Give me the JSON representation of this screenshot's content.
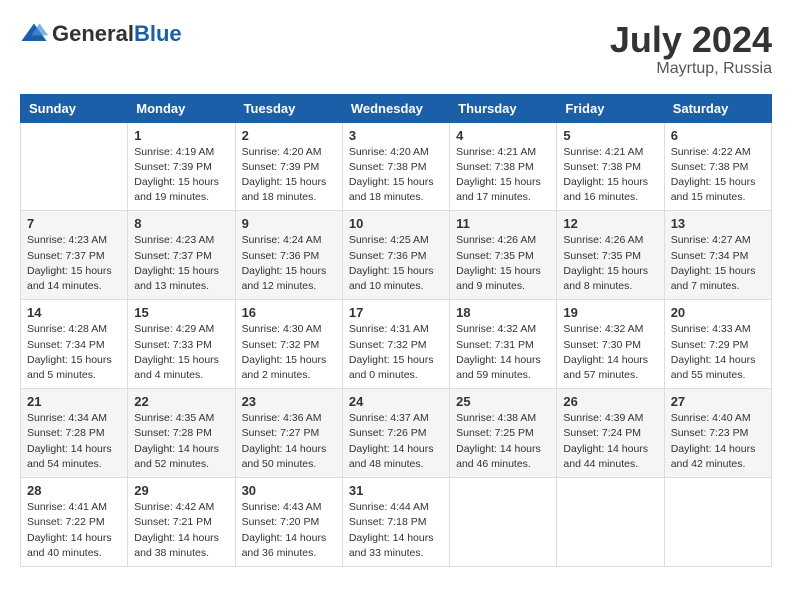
{
  "header": {
    "logo_general": "General",
    "logo_blue": "Blue",
    "month_year": "July 2024",
    "location": "Mayrtup, Russia"
  },
  "columns": [
    "Sunday",
    "Monday",
    "Tuesday",
    "Wednesday",
    "Thursday",
    "Friday",
    "Saturday"
  ],
  "weeks": [
    [
      {
        "day": "",
        "info": ""
      },
      {
        "day": "1",
        "info": "Sunrise: 4:19 AM\nSunset: 7:39 PM\nDaylight: 15 hours\nand 19 minutes."
      },
      {
        "day": "2",
        "info": "Sunrise: 4:20 AM\nSunset: 7:39 PM\nDaylight: 15 hours\nand 18 minutes."
      },
      {
        "day": "3",
        "info": "Sunrise: 4:20 AM\nSunset: 7:38 PM\nDaylight: 15 hours\nand 18 minutes."
      },
      {
        "day": "4",
        "info": "Sunrise: 4:21 AM\nSunset: 7:38 PM\nDaylight: 15 hours\nand 17 minutes."
      },
      {
        "day": "5",
        "info": "Sunrise: 4:21 AM\nSunset: 7:38 PM\nDaylight: 15 hours\nand 16 minutes."
      },
      {
        "day": "6",
        "info": "Sunrise: 4:22 AM\nSunset: 7:38 PM\nDaylight: 15 hours\nand 15 minutes."
      }
    ],
    [
      {
        "day": "7",
        "info": "Sunrise: 4:23 AM\nSunset: 7:37 PM\nDaylight: 15 hours\nand 14 minutes."
      },
      {
        "day": "8",
        "info": "Sunrise: 4:23 AM\nSunset: 7:37 PM\nDaylight: 15 hours\nand 13 minutes."
      },
      {
        "day": "9",
        "info": "Sunrise: 4:24 AM\nSunset: 7:36 PM\nDaylight: 15 hours\nand 12 minutes."
      },
      {
        "day": "10",
        "info": "Sunrise: 4:25 AM\nSunset: 7:36 PM\nDaylight: 15 hours\nand 10 minutes."
      },
      {
        "day": "11",
        "info": "Sunrise: 4:26 AM\nSunset: 7:35 PM\nDaylight: 15 hours\nand 9 minutes."
      },
      {
        "day": "12",
        "info": "Sunrise: 4:26 AM\nSunset: 7:35 PM\nDaylight: 15 hours\nand 8 minutes."
      },
      {
        "day": "13",
        "info": "Sunrise: 4:27 AM\nSunset: 7:34 PM\nDaylight: 15 hours\nand 7 minutes."
      }
    ],
    [
      {
        "day": "14",
        "info": "Sunrise: 4:28 AM\nSunset: 7:34 PM\nDaylight: 15 hours\nand 5 minutes."
      },
      {
        "day": "15",
        "info": "Sunrise: 4:29 AM\nSunset: 7:33 PM\nDaylight: 15 hours\nand 4 minutes."
      },
      {
        "day": "16",
        "info": "Sunrise: 4:30 AM\nSunset: 7:32 PM\nDaylight: 15 hours\nand 2 minutes."
      },
      {
        "day": "17",
        "info": "Sunrise: 4:31 AM\nSunset: 7:32 PM\nDaylight: 15 hours\nand 0 minutes."
      },
      {
        "day": "18",
        "info": "Sunrise: 4:32 AM\nSunset: 7:31 PM\nDaylight: 14 hours\nand 59 minutes."
      },
      {
        "day": "19",
        "info": "Sunrise: 4:32 AM\nSunset: 7:30 PM\nDaylight: 14 hours\nand 57 minutes."
      },
      {
        "day": "20",
        "info": "Sunrise: 4:33 AM\nSunset: 7:29 PM\nDaylight: 14 hours\nand 55 minutes."
      }
    ],
    [
      {
        "day": "21",
        "info": "Sunrise: 4:34 AM\nSunset: 7:28 PM\nDaylight: 14 hours\nand 54 minutes."
      },
      {
        "day": "22",
        "info": "Sunrise: 4:35 AM\nSunset: 7:28 PM\nDaylight: 14 hours\nand 52 minutes."
      },
      {
        "day": "23",
        "info": "Sunrise: 4:36 AM\nSunset: 7:27 PM\nDaylight: 14 hours\nand 50 minutes."
      },
      {
        "day": "24",
        "info": "Sunrise: 4:37 AM\nSunset: 7:26 PM\nDaylight: 14 hours\nand 48 minutes."
      },
      {
        "day": "25",
        "info": "Sunrise: 4:38 AM\nSunset: 7:25 PM\nDaylight: 14 hours\nand 46 minutes."
      },
      {
        "day": "26",
        "info": "Sunrise: 4:39 AM\nSunset: 7:24 PM\nDaylight: 14 hours\nand 44 minutes."
      },
      {
        "day": "27",
        "info": "Sunrise: 4:40 AM\nSunset: 7:23 PM\nDaylight: 14 hours\nand 42 minutes."
      }
    ],
    [
      {
        "day": "28",
        "info": "Sunrise: 4:41 AM\nSunset: 7:22 PM\nDaylight: 14 hours\nand 40 minutes."
      },
      {
        "day": "29",
        "info": "Sunrise: 4:42 AM\nSunset: 7:21 PM\nDaylight: 14 hours\nand 38 minutes."
      },
      {
        "day": "30",
        "info": "Sunrise: 4:43 AM\nSunset: 7:20 PM\nDaylight: 14 hours\nand 36 minutes."
      },
      {
        "day": "31",
        "info": "Sunrise: 4:44 AM\nSunset: 7:18 PM\nDaylight: 14 hours\nand 33 minutes."
      },
      {
        "day": "",
        "info": ""
      },
      {
        "day": "",
        "info": ""
      },
      {
        "day": "",
        "info": ""
      }
    ]
  ]
}
